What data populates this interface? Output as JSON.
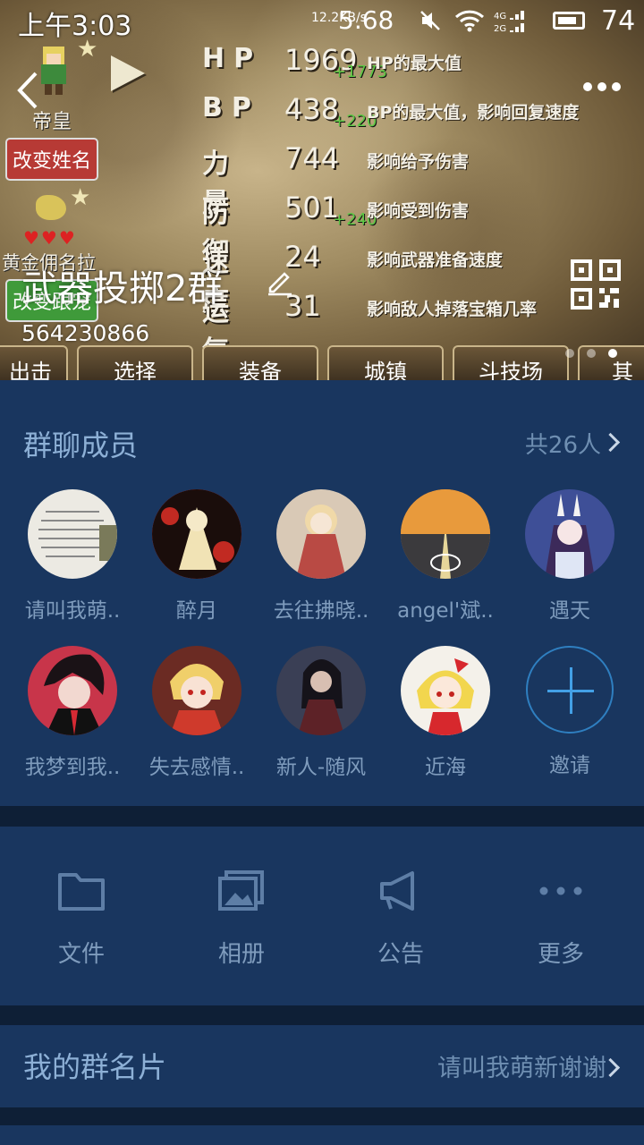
{
  "status_bar": {
    "time": "上午3:03",
    "speed": "12.2KB/s",
    "network_speed": "5.68",
    "battery": "74"
  },
  "game": {
    "stats": [
      {
        "label": "HP",
        "value": "1969",
        "bonus": "+1773",
        "desc": "HP的最大值"
      },
      {
        "label": "BP",
        "value": "438",
        "bonus": "+220",
        "desc": "BP的最大值，影响回复速度"
      },
      {
        "label": "力量",
        "value": "744",
        "bonus": "",
        "desc": "影响给予伤害"
      },
      {
        "label": "防御",
        "value": "501",
        "bonus": "+240",
        "desc": "影响受到伤害"
      },
      {
        "label": "速度",
        "value": "24",
        "bonus": "",
        "desc": "影响武器准备速度"
      },
      {
        "label": "运气",
        "value": "31",
        "bonus": "",
        "desc": "影响敌人掉落宝箱几率"
      }
    ],
    "character_title": "帝皇",
    "rename_label": "改变姓名",
    "follow_label": "改变跟宠",
    "pet_name": "黄金佣名拉",
    "tabs": [
      "出击",
      "选择",
      "装备",
      "城镇",
      "斗技场",
      "其"
    ]
  },
  "group": {
    "name": "武器投掷2群",
    "id": "564230866"
  },
  "members": {
    "title": "群聊成员",
    "count": "共26人",
    "list": [
      {
        "name": "请叫我萌..",
        "color": "#eceae3"
      },
      {
        "name": "醉月",
        "color": "#b3241f"
      },
      {
        "name": "去往拂晓..",
        "color": "#d9c9b6"
      },
      {
        "name": "angel'斌..",
        "color": "#d67a2e"
      },
      {
        "name": "遇天",
        "color": "#3e4f97"
      },
      {
        "name": "我梦到我..",
        "color": "#c8354a"
      },
      {
        "name": "失去感情..",
        "color": "#6b2b23"
      },
      {
        "name": "新人-随风",
        "color": "#3a3f55"
      },
      {
        "name": "近海",
        "color": "#f4f1ea"
      }
    ],
    "invite_label": "邀请"
  },
  "tools": [
    {
      "label": "文件",
      "icon": "folder-icon"
    },
    {
      "label": "相册",
      "icon": "album-icon"
    },
    {
      "label": "公告",
      "icon": "megaphone-icon"
    },
    {
      "label": "更多",
      "icon": "more-dots-icon"
    }
  ],
  "card": {
    "title": "我的群名片",
    "value": "请叫我萌新谢谢"
  }
}
